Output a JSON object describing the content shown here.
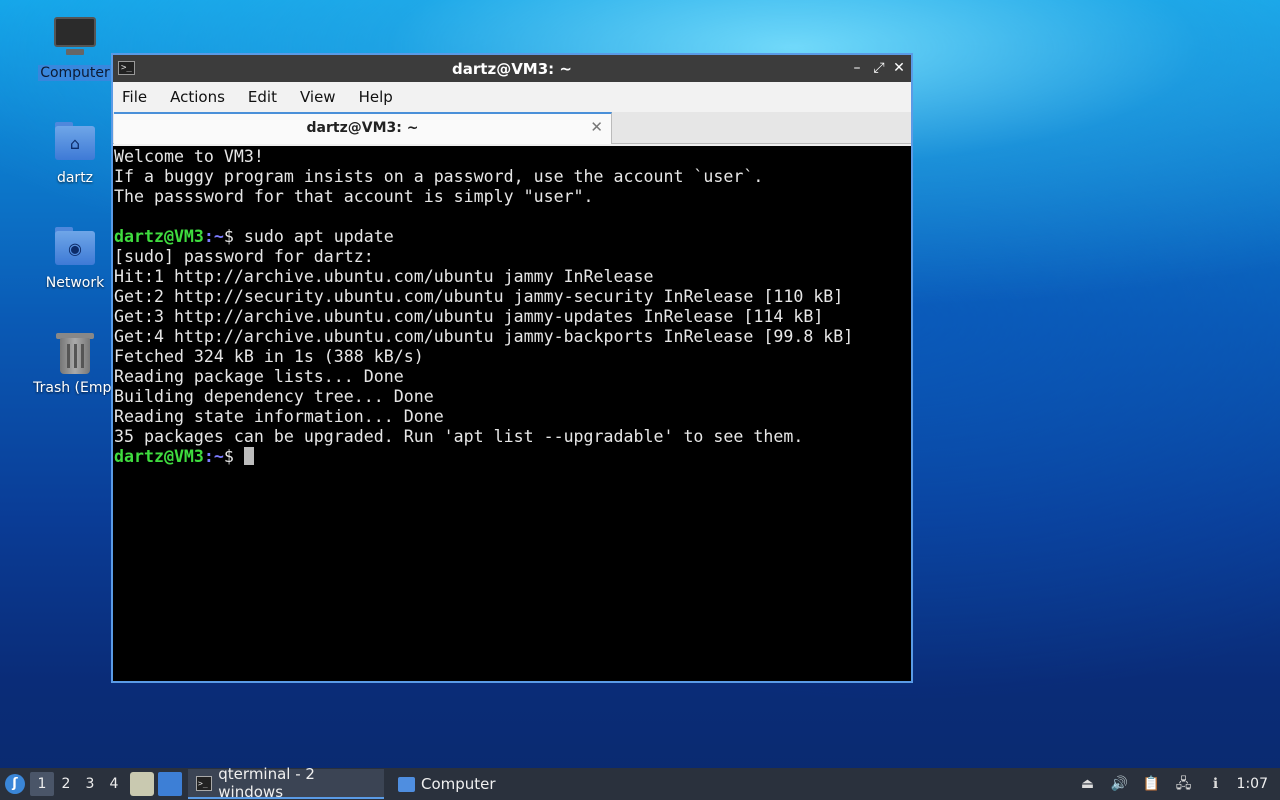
{
  "desktop": {
    "icons": [
      {
        "label": "Computer"
      },
      {
        "label": "dartz"
      },
      {
        "label": "Network"
      },
      {
        "label": "Trash (Empt"
      }
    ]
  },
  "window": {
    "icon_glyph": ">_",
    "title": "dartz@VM3: ~",
    "controls": {
      "minimize": "–",
      "maximize": "⤢",
      "close": "✕"
    },
    "menu": [
      "File",
      "Actions",
      "Edit",
      "View",
      "Help"
    ],
    "tab": {
      "title": "dartz@VM3: ~",
      "close": "✕"
    }
  },
  "terminal": {
    "prompt_user": "dartz@VM3",
    "prompt_path": ":~",
    "prompt_symbol": "$ ",
    "lines": [
      "Welcome to VM3!",
      "If a buggy program insists on a password, use the account `user`.",
      "The passsword for that account is simply \"user\".",
      "",
      "sudo apt update",
      "[sudo] password for dartz:",
      "Hit:1 http://archive.ubuntu.com/ubuntu jammy InRelease",
      "Get:2 http://security.ubuntu.com/ubuntu jammy-security InRelease [110 kB]",
      "Get:3 http://archive.ubuntu.com/ubuntu jammy-updates InRelease [114 kB]",
      "Get:4 http://archive.ubuntu.com/ubuntu jammy-backports InRelease [99.8 kB]",
      "Fetched 324 kB in 1s (388 kB/s)",
      "Reading package lists... Done",
      "Building dependency tree... Done",
      "Reading state information... Done",
      "35 packages can be upgraded. Run 'apt list --upgradable' to see them."
    ]
  },
  "taskbar": {
    "desktops": [
      "1",
      "2",
      "3",
      "4"
    ],
    "tasks": [
      {
        "label": "qterminal - 2 windows"
      },
      {
        "label": "Computer"
      }
    ],
    "clock": "1:07"
  },
  "colors": {
    "prompt_user": "#3fdc3f",
    "prompt_path": "#7b7bff",
    "window_border": "#5a9be6",
    "taskbar": "#2a313d"
  }
}
